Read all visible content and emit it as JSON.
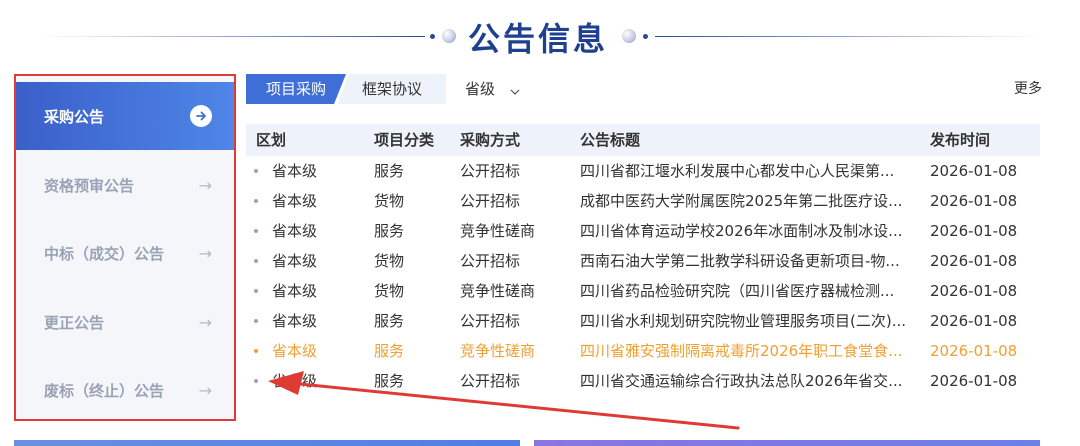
{
  "title": "公告信息",
  "sidebar": {
    "items": [
      {
        "label": "采购公告",
        "active": true
      },
      {
        "label": "资格预审公告",
        "active": false
      },
      {
        "label": "中标（成交）公告",
        "active": false
      },
      {
        "label": "更正公告",
        "active": false
      },
      {
        "label": "废标（终止）公告",
        "active": false
      }
    ]
  },
  "tabs": {
    "active_label": "项目采购",
    "inactive_label": "框架协议"
  },
  "filter": {
    "selected": "省级"
  },
  "more_label": "更多",
  "table": {
    "headers": {
      "district": "区划",
      "category": "项目分类",
      "method": "采购方式",
      "title": "公告标题",
      "date": "发布时间"
    },
    "rows": [
      {
        "district": "省本级",
        "category": "服务",
        "method": "公开招标",
        "title": "四川省都江堰水利发展中心都发中心人民渠第...",
        "date": "2026-01-08"
      },
      {
        "district": "省本级",
        "category": "货物",
        "method": "公开招标",
        "title": "成都中医药大学附属医院2025年第二批医疗设...",
        "date": "2026-01-08"
      },
      {
        "district": "省本级",
        "category": "服务",
        "method": "竞争性磋商",
        "title": "四川省体育运动学校2026年冰面制冰及制冰设...",
        "date": "2026-01-08"
      },
      {
        "district": "省本级",
        "category": "货物",
        "method": "公开招标",
        "title": "西南石油大学第二批教学科研设备更新项目-物...",
        "date": "2026-01-08"
      },
      {
        "district": "省本级",
        "category": "货物",
        "method": "竞争性磋商",
        "title": "四川省药品检验研究院（四川省医疗器械检测...",
        "date": "2026-01-08"
      },
      {
        "district": "省本级",
        "category": "服务",
        "method": "公开招标",
        "title": "四川省水利规划研究院物业管理服务项目(二次)...",
        "date": "2026-01-08"
      },
      {
        "district": "省本级",
        "category": "服务",
        "method": "竞争性磋商",
        "title": "四川省雅安强制隔离戒毒所2026年职工食堂食...",
        "date": "2026-01-08"
      },
      {
        "district": "省本级",
        "category": "服务",
        "method": "公开招标",
        "title": "四川省交通运输综合行政执法总队2026年省交...",
        "date": "2026-01-08"
      }
    ]
  },
  "colors": {
    "accent": "#3f6fd6",
    "title": "#1f3f8f",
    "highlight": "#f0a030",
    "annotation": "#e03a34"
  }
}
